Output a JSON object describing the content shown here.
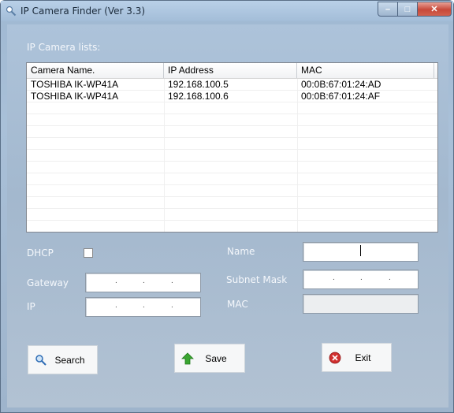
{
  "window": {
    "title": "IP Camera Finder (Ver 3.3)"
  },
  "caption": {
    "minimize": "–",
    "maximize": "□",
    "close": "✕"
  },
  "list": {
    "label": "IP Camera lists:",
    "columns": [
      "Camera Name.",
      "IP Address",
      "MAC"
    ],
    "rows": [
      [
        "TOSHIBA IK-WP41A",
        "192.168.100.5",
        "00:0B:67:01:24:AD"
      ],
      [
        "TOSHIBA IK-WP41A",
        "192.168.100.6",
        "00:0B:67:01:24:AF"
      ]
    ]
  },
  "form": {
    "dhcp_label": "DHCP",
    "gateway_label": "Gateway",
    "ip_label": "IP",
    "name_label": "Name",
    "subnet_label": "Subnet Mask",
    "mac_label": "MAC",
    "ip_placeholder": ".    .    ."
  },
  "buttons": {
    "search": "Search",
    "save": "Save",
    "exit": "Exit"
  },
  "colors": {
    "accent": "#a3bdd8",
    "close": "#c7493a",
    "save_icon": "#3aa531",
    "exit_icon": "#d12f2f"
  }
}
